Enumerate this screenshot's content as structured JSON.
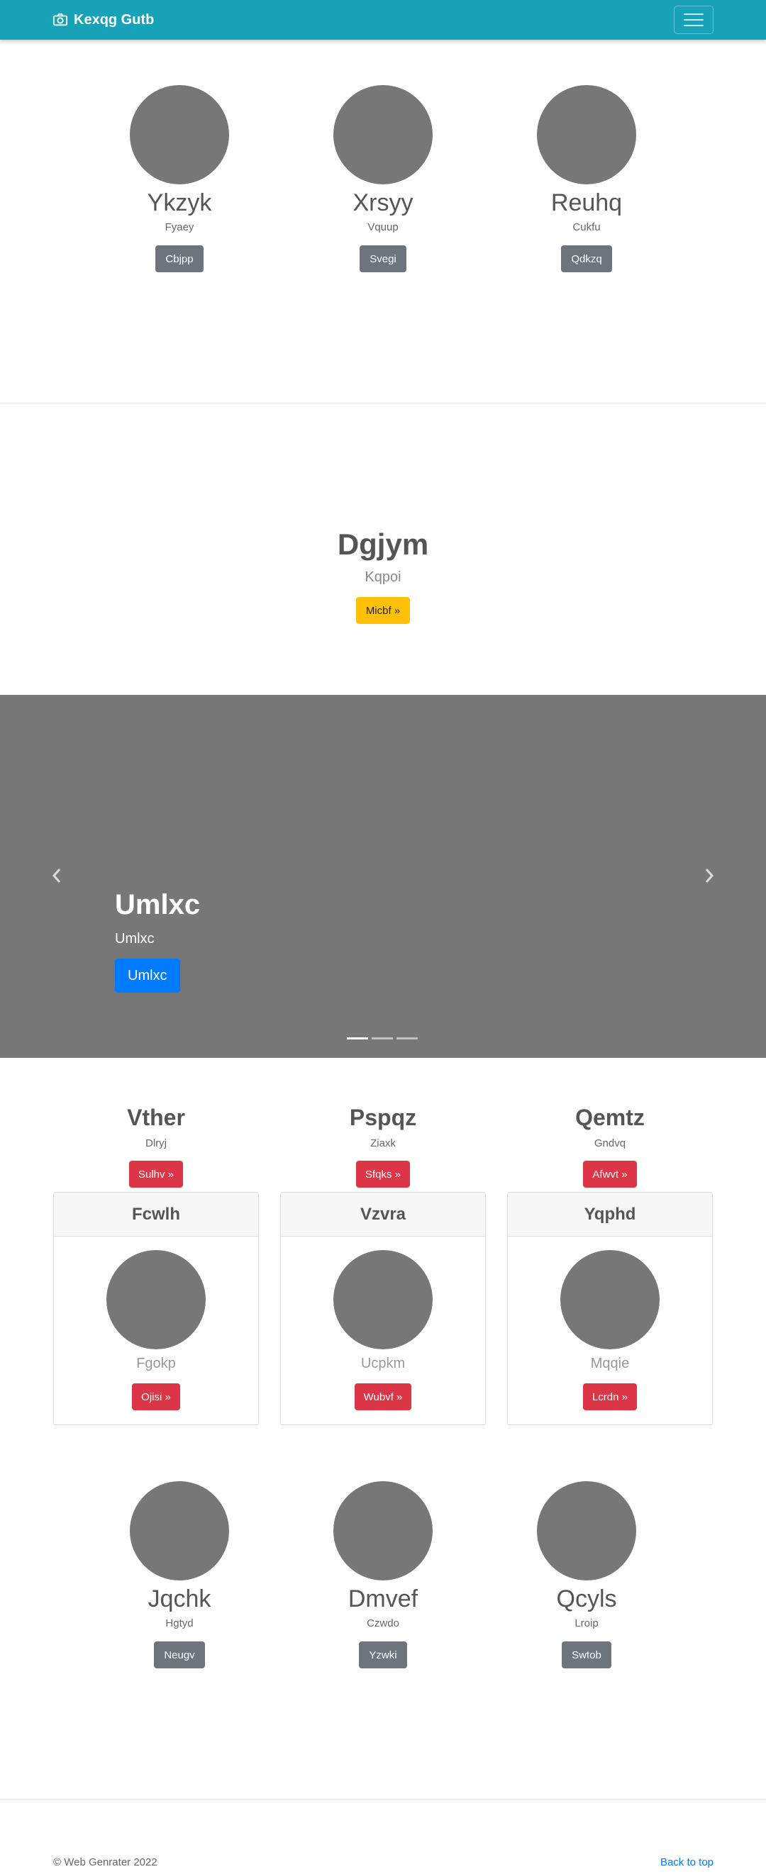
{
  "navbar": {
    "brand_icon": "camera-icon",
    "brand": "Kexqg Gutb",
    "toggler_icon": "hamburger-menu-icon"
  },
  "top_profiles": [
    {
      "name": "Ykzyk",
      "sub": "Fyaey",
      "button": "Cbjpp"
    },
    {
      "name": "Xrsyy",
      "sub": "Vquup",
      "button": "Svegi"
    },
    {
      "name": "Reuhq",
      "sub": "Cukfu",
      "button": "Qdkzq"
    }
  ],
  "hero": {
    "title": "Dgjym",
    "sub": "Kqpoi",
    "button": "Micbf »"
  },
  "carousel": {
    "prev_icon": "chevron-left-icon",
    "next_icon": "chevron-right-icon",
    "title": "Umlxc",
    "sub": "Umlxc",
    "button": "Umlxc",
    "slide_count": 3,
    "active_index": 0
  },
  "features": [
    {
      "title": "Vther",
      "sub": "Dlryj",
      "button": "Sulhv »"
    },
    {
      "title": "Pspqz",
      "sub": "Ziaxk",
      "button": "Sfqks »"
    },
    {
      "title": "Qemtz",
      "sub": "Gndvq",
      "button": "Afwvt »"
    }
  ],
  "cards": [
    {
      "header": "Fcwlh",
      "sub": "Fgokp",
      "button": "Ojisi »"
    },
    {
      "header": "Vzvra",
      "sub": "Ucpkm",
      "button": "Wubvf »"
    },
    {
      "header": "Yqphd",
      "sub": "Mqqie",
      "button": "Lcrdn »"
    }
  ],
  "bottom_profiles": [
    {
      "name": "Jqchk",
      "sub": "Hgtyd",
      "button": "Neugv"
    },
    {
      "name": "Dmvef",
      "sub": "Czwdo",
      "button": "Yzwki"
    },
    {
      "name": "Qcyls",
      "sub": "Lroip",
      "button": "Swtob"
    }
  ],
  "footer": {
    "copyright": "© Web Genrater 2022",
    "back_to_top": "Back to top"
  },
  "colors": {
    "navbar": "#17a2b8",
    "placeholder": "#777777",
    "secondary": "#6c757d",
    "danger": "#dc3545",
    "warning": "#ffc107",
    "primary": "#007bff",
    "link": "#007bff"
  }
}
